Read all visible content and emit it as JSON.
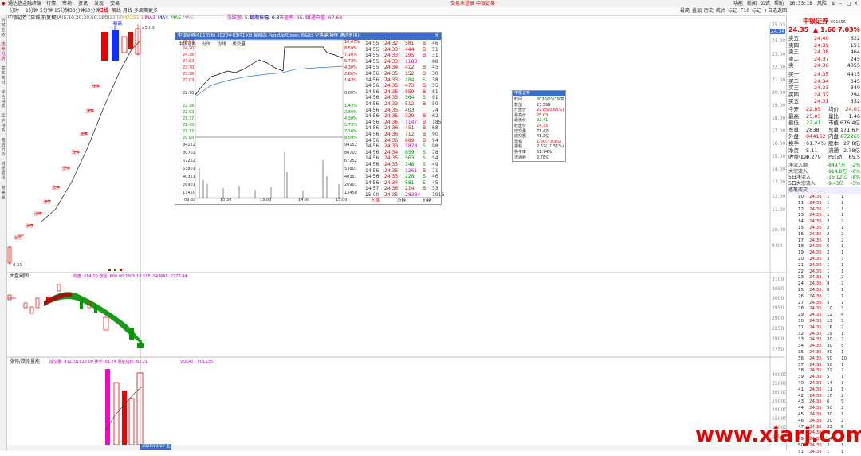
{
  "titlebar": {
    "app_name": "通达信金融终端",
    "menu": [
      "行情",
      "市场",
      "资讯",
      "发现",
      "交易"
    ],
    "center_left": "交易未登录",
    "center_right": "中银证券",
    "right_menu": [
      "功能",
      "新闻",
      "公式",
      "帮助"
    ],
    "time": "16:33:18",
    "window_label": "风险"
  },
  "toolbar": {
    "periods": [
      "分时",
      "1分钟",
      "5分钟",
      "15分钟",
      "30分钟",
      "60分钟",
      "日线",
      "周线",
      "月线",
      "多周期",
      "更多"
    ],
    "active_period": "日线",
    "right_tools": [
      "最简",
      "叠加",
      "历史",
      "统计",
      "标记",
      "F10",
      "标记",
      "+自选",
      "返回"
    ]
  },
  "sidebar": {
    "tabs": [
      "分时走势",
      "技术分析",
      "基本资料",
      "综合排名",
      "深沪排名",
      "盘后分析",
      "财经资讯",
      "港美股"
    ]
  },
  "chart_header": {
    "stock": "中银证券 (日线,前复权)",
    "ma_line": "MA(5,10,20,30,60,120)",
    "ma1": "MA1",
    "ma1_val": "23.50",
    "ma2": "MA2",
    "ma2_val": "21.13",
    "ma3": "MA3",
    "ma4": "MA4",
    "ma5": "MA5",
    "ma6": "MA6",
    "stat1": "涨跌额: 5.11",
    "stat2": "周期振幅: 0.37",
    "stat3": "市盈率: 65.45",
    "stat4": "流通市值: 67.68"
  },
  "price_axis": [
    "25.03",
    "24.00",
    "23.00",
    "22.00",
    "21.00",
    "20.00",
    "19.00",
    "18.00",
    "17.00",
    "16.00",
    "15.00",
    "14.00",
    "13.00",
    "12.00",
    "11.00",
    "10.00",
    "9.00"
  ],
  "price_current": "24.34",
  "main_labels": {
    "high_label": "25.03",
    "low_label": "6.59",
    "up_tag": "涨停",
    "badge_new": "新高"
  },
  "subchart1": {
    "title": "大盘副图",
    "vals": "收盘: 684.00  涨幅: 600.00  3305.18  SSE: 34  MA5: 2777.44",
    "axis": [
      "3100",
      "3050",
      "3000",
      "2950",
      "2900",
      "2850",
      "2800",
      "2750"
    ]
  },
  "subchart2": {
    "title": "涨停/跌停量能",
    "vals": "成交量: 412101632.00  换手: 61.74  量能指标: 82.21",
    "vol_label": "VOL40 - VOL135",
    "axis": [
      "40000",
      "35000",
      "30000",
      "25000",
      "20000",
      "15000",
      "10000",
      "5000"
    ]
  },
  "bottom_date": "2020/03/20 五",
  "popup": {
    "title": "中银证券(601696) 2020年03月19日 星期四 PageUp/Down:前后日 空格键:操作 通达信(R)",
    "tabs": [
      "中银证券",
      "分时",
      "均线",
      "成交量"
    ],
    "left_axis": [
      "25.03",
      "24.70",
      "24.36",
      "24.03",
      "23.70",
      "23.36",
      "23.03",
      "22.70",
      "22.36",
      "22.03",
      "21.77",
      "21.45",
      "21.12",
      "20.80"
    ],
    "right_axis": [
      "10.07%",
      "8.59%",
      "7.16%",
      "5.73%",
      "4.30%",
      "2.86%",
      "1.43%",
      "0.00%",
      "1.43%",
      "2.86%",
      "4.30%",
      "5.73%",
      "7.16%",
      "8.59%"
    ],
    "vol_axis": [
      "94152",
      "80702",
      "67252",
      "53801",
      "40351",
      "26901",
      "13450"
    ],
    "time_axis": [
      "09:30",
      "10:30",
      "13:00",
      "14:00",
      "15:00"
    ],
    "footer_tabs": [
      "分笔",
      "分钟",
      "价格"
    ],
    "ticks": [
      [
        "14:55",
        "24.32",
        "581",
        "B",
        "46"
      ],
      [
        "14:55",
        "24.33",
        "444",
        "B",
        "51"
      ],
      [
        "14:55",
        "24.33",
        "295",
        "B",
        "31"
      ],
      [
        "14:55",
        "24.33",
        "1183",
        "",
        "88"
      ],
      [
        "14:55",
        "24.34",
        "412",
        "B",
        "45"
      ],
      [
        "14:56",
        "24.35",
        "152",
        "B",
        "30"
      ],
      [
        "14:56",
        "24.33",
        "184",
        "S",
        "38"
      ],
      [
        "14:56",
        "24.35",
        "473",
        "B",
        "55"
      ],
      [
        "14:56",
        "24.35",
        "859",
        "B",
        "81"
      ],
      [
        "14:56",
        "24.35",
        "564",
        "S",
        "91"
      ],
      [
        "14:56",
        "24.33",
        "512",
        "B",
        "50"
      ],
      [
        "14:56",
        "24.35",
        "403",
        "",
        "74"
      ],
      [
        "14:56",
        "24.35",
        "329",
        "B",
        "62"
      ],
      [
        "14:56",
        "24.36",
        "1147",
        "B",
        "185"
      ],
      [
        "14:56",
        "24.36",
        "451",
        "B",
        "68"
      ],
      [
        "14:56",
        "24.36",
        "712",
        "B",
        "90"
      ],
      [
        "14:56",
        "24.36",
        "889",
        "B",
        "94"
      ],
      [
        "14:56",
        "24.33",
        "1828",
        "S",
        "98"
      ],
      [
        "14:56",
        "24.34",
        "859",
        "S",
        "78"
      ],
      [
        "14:56",
        "24.35",
        "563",
        "S",
        "54"
      ],
      [
        "14:56",
        "24.33",
        "348",
        "S",
        "49"
      ],
      [
        "14:56",
        "24.35",
        "1261",
        "B",
        "71"
      ],
      [
        "14:56",
        "24.33",
        "228",
        "S",
        "46"
      ],
      [
        "14:56",
        "24.34",
        "581",
        "S",
        "45"
      ],
      [
        "14:57",
        "24.36",
        "214",
        "B",
        "33"
      ],
      [
        "15:00",
        "24.35",
        "28384",
        "",
        "1916"
      ]
    ]
  },
  "infobox": {
    "title": "中银证券",
    "rows": [
      [
        "时间",
        "2020/03/19/四"
      ],
      [
        "数值",
        "23.569"
      ],
      [
        "开盘价",
        "22.85(0.66%)"
      ],
      [
        "最高价",
        "25.03"
      ],
      [
        "最低价",
        "22.41"
      ],
      [
        "收盘价",
        "24.35"
      ],
      [
        "成交量",
        "71.4万"
      ],
      [
        "成交额",
        "41.3亿"
      ],
      [
        "涨幅",
        "1.60(7.03%)"
      ],
      [
        "振幅",
        "2.62(11.51%)"
      ],
      [
        "换手率",
        "61.74%"
      ],
      [
        "流通股",
        "2.78亿"
      ]
    ]
  },
  "rightpanel": {
    "name": "中银证券",
    "code": "601696",
    "price": "24.35",
    "change": "1.60",
    "pct": "7.03%",
    "asks": [
      [
        "卖五",
        "24.40",
        "622"
      ],
      [
        "卖四",
        "24.39",
        "151"
      ],
      [
        "卖三",
        "24.38",
        "464"
      ],
      [
        "卖二",
        "24.37",
        "245"
      ],
      [
        "卖一",
        "24.36",
        "4055"
      ]
    ],
    "bids": [
      [
        "买一",
        "24.35",
        "4415"
      ],
      [
        "买二",
        "24.34",
        "345"
      ],
      [
        "买三",
        "24.33",
        "349"
      ],
      [
        "买四",
        "24.32",
        "294"
      ],
      [
        "买五",
        "24.31",
        "552"
      ]
    ],
    "stats": [
      [
        "今开",
        "22.85",
        "均价",
        "24.01"
      ],
      [
        "最高",
        "25.03",
        "量比",
        "1.46"
      ],
      [
        "最低",
        "22.41",
        "市值",
        "676.4亿"
      ],
      [
        "总量",
        "2838",
        "总量",
        "171.6万"
      ],
      [
        "外盘",
        "844162",
        "内盘",
        "872265"
      ],
      [
        "换手",
        "61.74%",
        "股本",
        "27.8亿"
      ],
      [
        "净资",
        "5.11",
        "流通",
        "2.78亿"
      ],
      [
        "收益(四)",
        "0.279",
        "PE(动)",
        "65.5"
      ]
    ],
    "flows": [
      [
        "净流入额",
        "-8497万",
        "-2%"
      ],
      [
        "大宗流入",
        "-914.8万",
        "-0%"
      ],
      [
        "5日净流入",
        "-16.12亿",
        "-8%"
      ],
      [
        "5日大宗流入",
        "-9.43亿",
        "-5%"
      ]
    ],
    "tick_header": "逐笔成交",
    "tick_rows": [
      [
        "10",
        "24.35",
        "1",
        "1"
      ],
      [
        "11",
        "24.35",
        "1",
        "1"
      ],
      [
        "12",
        "24.35",
        "1",
        "1"
      ],
      [
        "13",
        "24.35",
        "1",
        "1"
      ],
      [
        "14",
        "24.35",
        "2",
        "2"
      ],
      [
        "15",
        "24.35",
        "2",
        "1"
      ],
      [
        "16",
        "24.35",
        "2",
        "2"
      ],
      [
        "17",
        "24.35",
        "3",
        "2"
      ],
      [
        "18",
        "24.35",
        "5",
        "1"
      ],
      [
        "19",
        "24.35",
        "2",
        "1"
      ],
      [
        "20",
        "24.35",
        "3",
        "3"
      ],
      [
        "21",
        "24.35",
        "1",
        "1"
      ],
      [
        "22",
        "24.35",
        "1",
        "1"
      ],
      [
        "23",
        "24.35",
        "4",
        "2"
      ],
      [
        "24",
        "24.35",
        "9",
        "2"
      ],
      [
        "25",
        "24.35",
        "6",
        "1"
      ],
      [
        "26",
        "24.35",
        "1",
        "1"
      ],
      [
        "27",
        "24.35",
        "5",
        "1"
      ],
      [
        "28",
        "24.35",
        "10",
        "3"
      ],
      [
        "29",
        "24.35",
        "12",
        "4"
      ],
      [
        "30",
        "24.35",
        "13",
        "3"
      ],
      [
        "31",
        "24.35",
        "16",
        "2"
      ],
      [
        "32",
        "24.35",
        "19",
        "1"
      ],
      [
        "33",
        "24.35",
        "20",
        "2"
      ],
      [
        "34",
        "24.35",
        "30",
        "5"
      ],
      [
        "35",
        "24.35",
        "40",
        "1"
      ],
      [
        "36",
        "24.35",
        "50",
        "10"
      ],
      [
        "37",
        "24.35",
        "50",
        "1"
      ],
      [
        "38",
        "24.35",
        "22",
        "2"
      ],
      [
        "39",
        "24.35",
        "5",
        "1"
      ],
      [
        "40",
        "24.35",
        "14",
        "3"
      ],
      [
        "41",
        "24.35",
        "11",
        "1"
      ],
      [
        "42",
        "24.35",
        "10",
        "2"
      ],
      [
        "43",
        "24.35",
        "6",
        "5"
      ],
      [
        "44",
        "24.35",
        "50",
        "2"
      ],
      [
        "45",
        "24.35",
        "30",
        "1"
      ],
      [
        "46",
        "24.35",
        "20",
        "2"
      ],
      [
        "47",
        "24.35",
        "22",
        "5"
      ],
      [
        "48",
        "24.35",
        "2",
        "1"
      ],
      [
        "49",
        "24.35",
        "14",
        "1"
      ],
      [
        "50",
        "24.35",
        "2",
        "1"
      ],
      [
        "51",
        "24.35",
        "1",
        "1"
      ]
    ]
  },
  "watermark": "www.xiarj.com",
  "colors": {
    "up": "#e00000",
    "down": "#009a00",
    "accent": "#3b6ec6",
    "magenta": "#ff00cc"
  }
}
